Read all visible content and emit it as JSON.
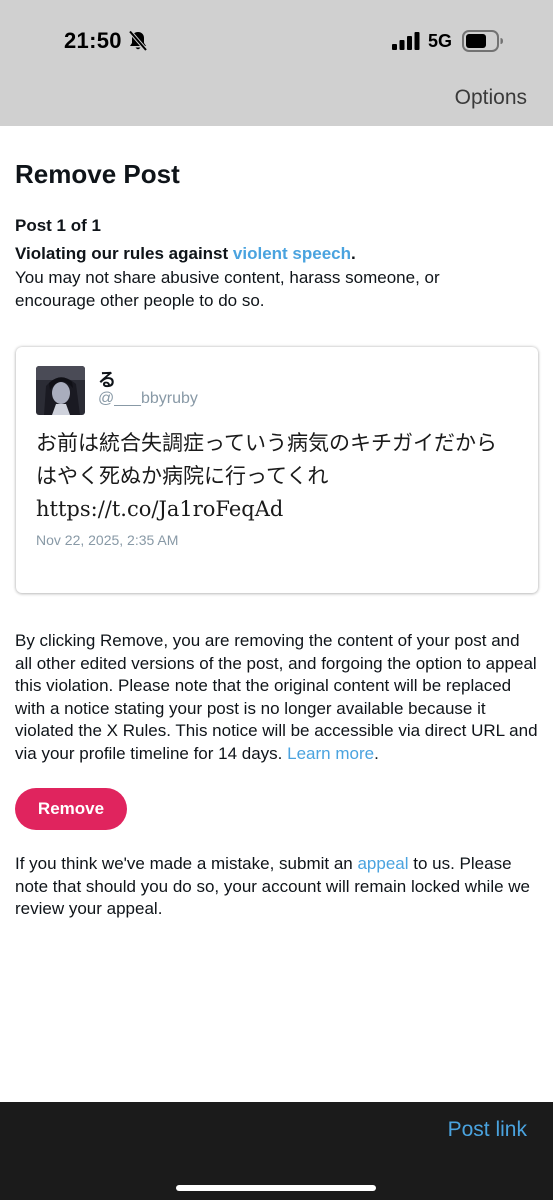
{
  "status_bar": {
    "time": "21:50",
    "network": "5G",
    "icons": [
      "bell-slash-icon",
      "signal-icon",
      "battery-icon"
    ]
  },
  "header": {
    "options_label": "Options"
  },
  "page": {
    "title": "Remove Post",
    "post_count": "Post 1 of 1",
    "rule_prefix": "Violating our rules against ",
    "rule_link": "violent speech",
    "rule_suffix": ".",
    "rule_description": "You may not share abusive content, harass someone, or encourage other people to do so."
  },
  "tweet": {
    "display_name": "る",
    "handle": "@___bbyruby",
    "text": "お前は統合失調症っていう病気のキチガイだからはやく死ぬか病院に行ってくれ https://t.co/Ja1roFeqAd",
    "date": "Nov 22, 2025, 2:35 AM"
  },
  "notice": {
    "text": "By clicking Remove, you are removing the content of your post and all other edited versions of the post, and forgoing the option to appeal this violation. Please note that the original content will be replaced with a notice stating your post is no longer available because it violated the X Rules. This notice will be accessible via direct URL and via your profile timeline for 14 days. ",
    "link": "Learn more",
    "suffix": "."
  },
  "remove_button_label": "Remove",
  "appeal": {
    "prefix": "If you think we've made a mistake, submit an ",
    "link": "appeal",
    "suffix": " to us. Please note that should you do so, your account will remain locked while we review your appeal."
  },
  "bottom_bar": {
    "post_link_label": "Post link"
  },
  "colors": {
    "link": "#4aa3df",
    "remove_button": "#e0245e",
    "chrome_gray": "#d0d0d0",
    "bottom_bar": "#1b1b1b"
  }
}
